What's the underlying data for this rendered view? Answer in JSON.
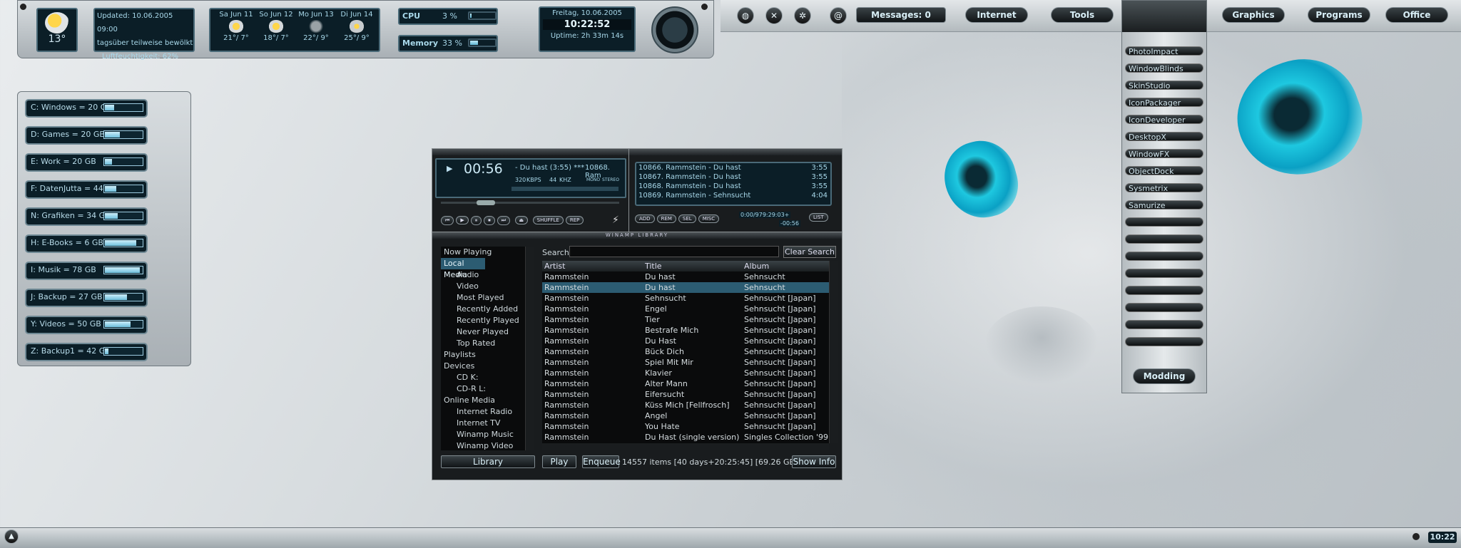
{
  "weather": {
    "temp": "13°",
    "updated": "Updated: 10.06.2005 09:00",
    "desc": "tagsüber teilweise bewölkt",
    "humidity": "Luftfeuchtigkeit: 62%",
    "forecast": [
      {
        "day": "Sa",
        "date": "Jun 11",
        "temp": "21°/ 7°"
      },
      {
        "day": "So",
        "date": "Jun 12",
        "temp": "18°/ 7°"
      },
      {
        "day": "Mo",
        "date": "Jun 13",
        "temp": "22°/ 9°"
      },
      {
        "day": "Di",
        "date": "Jun 14",
        "temp": "25°/ 9°"
      }
    ]
  },
  "system": {
    "cpu_label": "CPU",
    "cpu_value": "3 %",
    "cpu_fill": 3,
    "mem_label": "Memory",
    "mem_value": "33 %",
    "mem_fill": 33
  },
  "clock": {
    "date": "Freitag, 10.06.2005",
    "time": "10:22:52",
    "uptime": "Uptime: 2h 33m 14s"
  },
  "topbar": {
    "messages": "Messages: 0",
    "menus": [
      "Internet",
      "Tools",
      "Graphics",
      "Programs",
      "Office"
    ],
    "icons": [
      "globe-icon",
      "tools-icon",
      "asterisk-icon",
      "at-icon"
    ]
  },
  "drives": [
    {
      "label": "C: Windows = 20 GB",
      "fill": 25
    },
    {
      "label": "D: Games = 20 GB",
      "fill": 40
    },
    {
      "label": "E: Work = 20 GB",
      "fill": 20
    },
    {
      "label": "F: DatenJutta = 44 GB",
      "fill": 30
    },
    {
      "label": "N: Grafiken = 34 GB",
      "fill": 35
    },
    {
      "label": "H: E-Books = 6 GB",
      "fill": 85
    },
    {
      "label": "I: Musik = 78 GB",
      "fill": 95
    },
    {
      "label": "J: Backup = 27 GB",
      "fill": 60
    },
    {
      "label": "Y: Videos = 50 GB",
      "fill": 70
    },
    {
      "label": "Z: Backup1 = 42 GB",
      "fill": 10
    }
  ],
  "modding": {
    "items": [
      "PhotoImpact",
      "WindowBlinds",
      "SkinStudio",
      "IconPackager",
      "IconDeveloper",
      "DesktopX",
      "WindowFX",
      "ObjectDock",
      "Sysmetrix",
      "Samurize"
    ],
    "button": "Modding"
  },
  "winamp": {
    "time": "00:56",
    "track": "- Du hast (3:55) ***",
    "track_num": "10868. Ram",
    "kbps": "320",
    "khz": "44",
    "kbps_unit": "KBPS",
    "khz_unit": "KHZ",
    "mono": "MONO",
    "stereo": "STEREO",
    "shuffle": "SHUFFLE",
    "rep": "REP",
    "playlist": [
      {
        "title": "10866. Rammstein - Du hast",
        "len": "3:55"
      },
      {
        "title": "10867. Rammstein - Du hast",
        "len": "3:55"
      },
      {
        "title": "10868. Rammstein - Du hast",
        "len": "3:55"
      },
      {
        "title": "10869. Rammstein - Sehnsucht",
        "len": "4:04"
      }
    ],
    "pl_buttons": [
      "ADD",
      "REM",
      "SEL",
      "MISC"
    ],
    "pl_time": "0:00/979:29:03+",
    "pl_time2": "-00:56",
    "list_btn": "LIST"
  },
  "library": {
    "title": "WINAMP LIBRARY",
    "search_label": "Search:",
    "clear": "Clear Search",
    "tree": [
      {
        "t": "Now Playing",
        "l": 0
      },
      {
        "t": "Local Media",
        "l": 0,
        "sel": true
      },
      {
        "t": "Audio",
        "l": 1
      },
      {
        "t": "Video",
        "l": 1
      },
      {
        "t": "Most Played",
        "l": 1
      },
      {
        "t": "Recently Added",
        "l": 1
      },
      {
        "t": "Recently Played",
        "l": 1
      },
      {
        "t": "Never Played",
        "l": 1
      },
      {
        "t": "Top Rated",
        "l": 1
      },
      {
        "t": "Playlists",
        "l": 0
      },
      {
        "t": "Devices",
        "l": 0
      },
      {
        "t": "CD K:",
        "l": 1
      },
      {
        "t": "CD-R L:",
        "l": 1
      },
      {
        "t": "Online Media",
        "l": 0
      },
      {
        "t": "Internet Radio",
        "l": 1
      },
      {
        "t": "Internet TV",
        "l": 1
      },
      {
        "t": "Winamp Music",
        "l": 1
      },
      {
        "t": "Winamp Video",
        "l": 1
      }
    ],
    "columns": [
      "Artist",
      "Title",
      "Album"
    ],
    "rows": [
      [
        "Rammstein",
        "Du hast",
        "Sehnsucht"
      ],
      [
        "Rammstein",
        "Du hast",
        "Sehnsucht"
      ],
      [
        "Rammstein",
        "Sehnsucht",
        "Sehnsucht [Japan]"
      ],
      [
        "Rammstein",
        "Engel",
        "Sehnsucht [Japan]"
      ],
      [
        "Rammstein",
        "Tier",
        "Sehnsucht [Japan]"
      ],
      [
        "Rammstein",
        "Bestrafe Mich",
        "Sehnsucht [Japan]"
      ],
      [
        "Rammstein",
        "Du Hast",
        "Sehnsucht [Japan]"
      ],
      [
        "Rammstein",
        "Bück Dich",
        "Sehnsucht [Japan]"
      ],
      [
        "Rammstein",
        "Spiel Mit Mir",
        "Sehnsucht [Japan]"
      ],
      [
        "Rammstein",
        "Klavier",
        "Sehnsucht [Japan]"
      ],
      [
        "Rammstein",
        "Alter Mann",
        "Sehnsucht [Japan]"
      ],
      [
        "Rammstein",
        "Eifersucht",
        "Sehnsucht [Japan]"
      ],
      [
        "Rammstein",
        "Küss Mich [Fellfrosch]",
        "Sehnsucht [Japan]"
      ],
      [
        "Rammstein",
        "Angel",
        "Sehnsucht [Japan]"
      ],
      [
        "Rammstein",
        "You Hate",
        "Sehnsucht [Japan]"
      ],
      [
        "Rammstein",
        "Du Hast (single version)",
        "Singles Collection '99"
      ]
    ],
    "library_btn": "Library",
    "play": "Play",
    "enqueue": "Enqueue",
    "status": "14557 items [40 days+20:25:45] [69.26 GB]",
    "show_info": "Show Info"
  },
  "taskbar": {
    "time": "10:22"
  }
}
